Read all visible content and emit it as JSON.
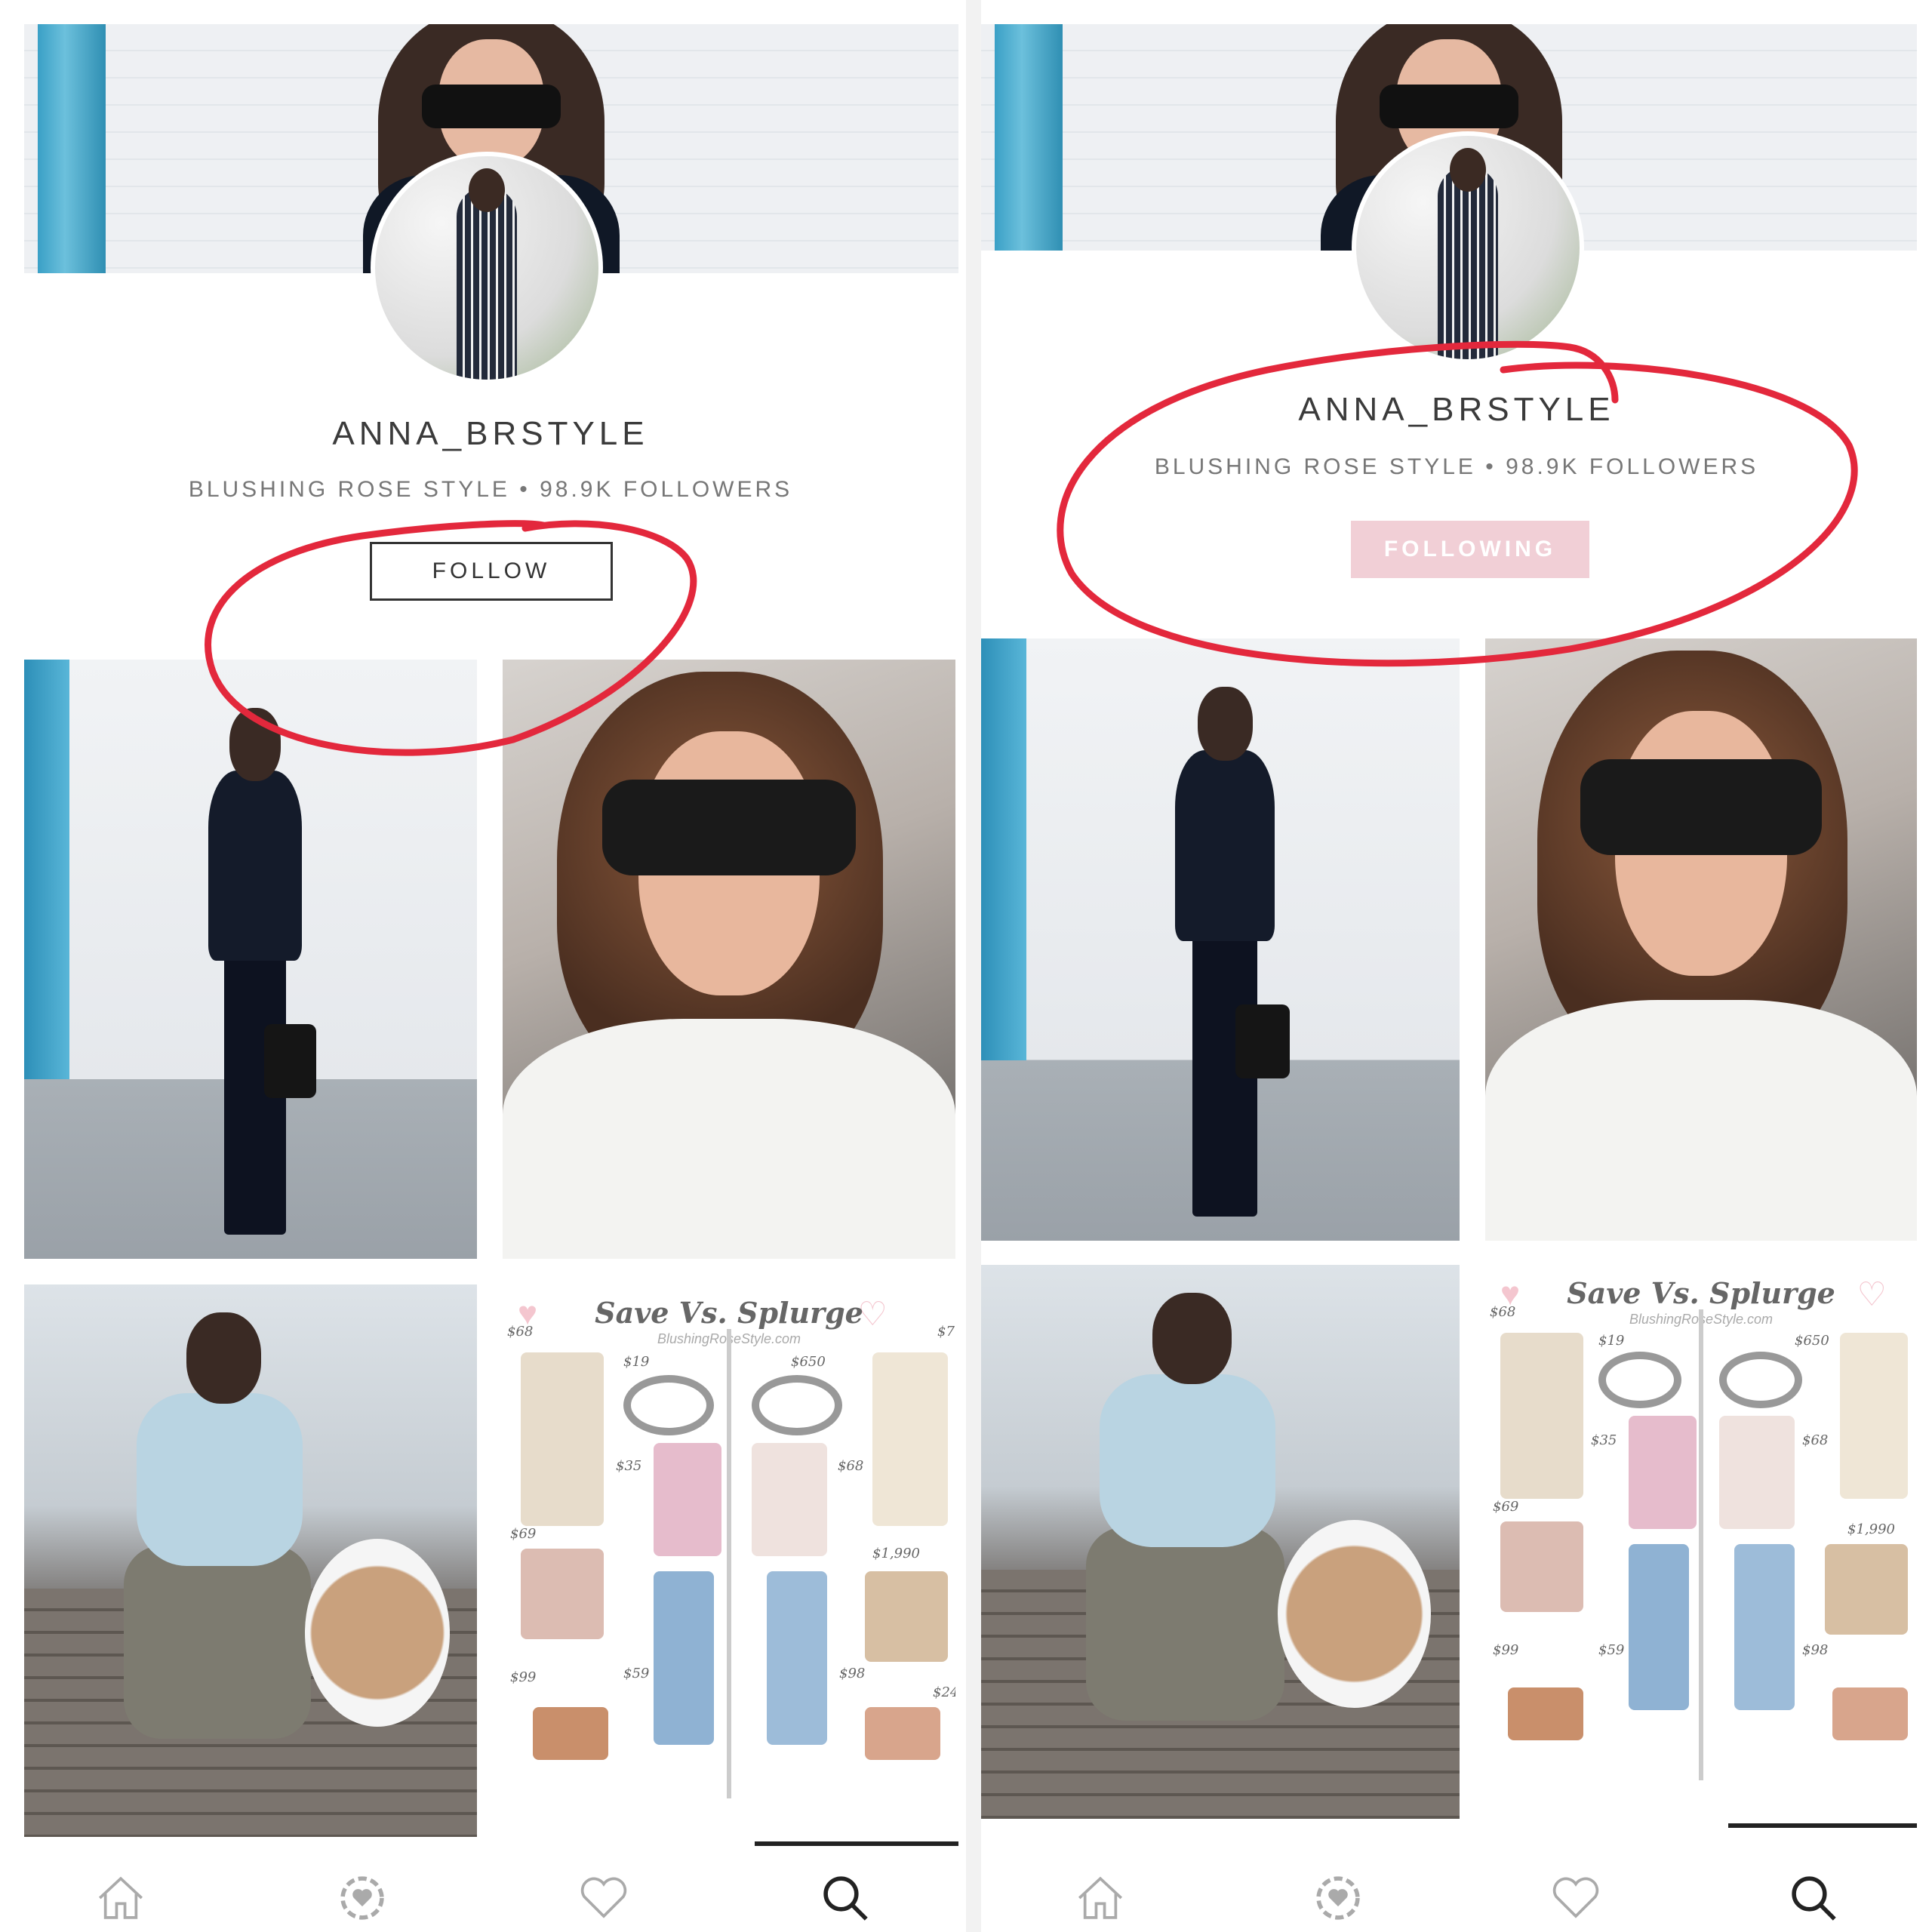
{
  "profile": {
    "username": "ANNA_BRSTYLE",
    "subtitle": "BLUSHING ROSE STYLE • 98.9K FOLLOWERS"
  },
  "left_screen": {
    "follow_label": "FOLLOW",
    "follow_state": "not-following"
  },
  "right_screen": {
    "follow_label": "FOLLOWING",
    "follow_state": "following"
  },
  "collage": {
    "title": "Save Vs. Splurge",
    "website": "BlushingRoseStyle.com",
    "prices_left": [
      "$68",
      "$19",
      "$35",
      "$69",
      "$59",
      "$99"
    ],
    "prices_right_left_screen": [
      "$650",
      "$68",
      "$1,990",
      "$98",
      "$24"
    ],
    "prices_right_right_screen": [
      "$650",
      "$68",
      "$1,990",
      "$98"
    ]
  },
  "nav": {
    "items": [
      "home-icon",
      "rewards-icon",
      "favorites-icon",
      "search-icon"
    ],
    "active": "search-icon"
  },
  "annotation_color": "#e3283c",
  "colors": {
    "following_bg": "#f1cfd6",
    "text_dark": "#3b3b3b",
    "text_muted": "#777777"
  }
}
